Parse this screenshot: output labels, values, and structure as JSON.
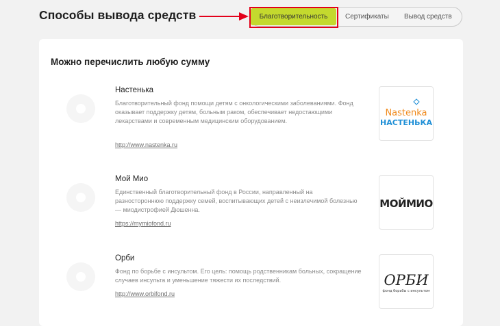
{
  "header": {
    "title": "Способы вывода средств"
  },
  "tabs": [
    {
      "label": "Благотворительность",
      "active": true
    },
    {
      "label": "Сертификаты",
      "active": false
    },
    {
      "label": "Вывод средств",
      "active": false
    }
  ],
  "card": {
    "title": "Можно перечислить любую сумму",
    "funds": [
      {
        "name": "Настенька",
        "description": "Благотворительный фонд помощи детям с онкологическими заболеваниями. Фонд оказывает поддержку детям, больным раком, обеспечивает недостающими лекарствами и современным медицинским оборудованием.",
        "link": "http://www.nastenka.ru",
        "logo_text": [
          "Nastenka",
          "НАСТЕНЬКА"
        ]
      },
      {
        "name": "Мой Мио",
        "description": "Единственный благотворительный фонд в России, направленный на разностороннюю поддержку семей, воспитывающих детей с неизлечимой болезнью — миодистрофией Дюшенна.",
        "link": "https://mymiofond.ru",
        "logo_text": [
          "МОЙМИО"
        ]
      },
      {
        "name": "Орби",
        "description": "Фонд по борьбе с инсультом. Его цель: помощь родственникам больных, сокращение случаев инсульта и уменьшение тяжести их последствий.",
        "link": "http://www.orbifond.ru",
        "logo_text": [
          "ОРБИ",
          "фонд борьбы с инсультом"
        ]
      }
    ]
  },
  "colors": {
    "accent": "#c4d92e",
    "highlight": "#e3001b",
    "nastenka_orange": "#f08a1c",
    "nastenka_blue": "#1f8fd6"
  }
}
